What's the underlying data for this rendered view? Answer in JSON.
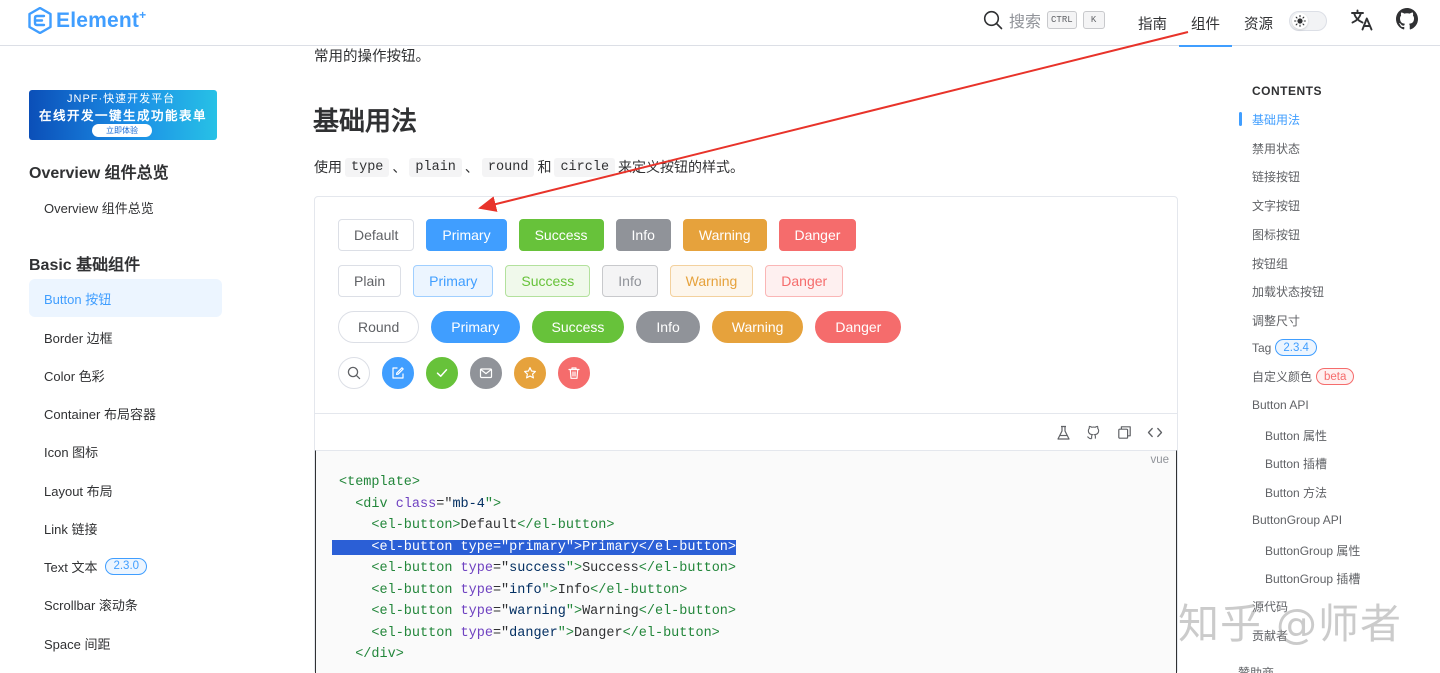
{
  "header": {
    "logo": "Element",
    "logo_sup": "+",
    "search_label": "搜索",
    "kbd_ctrl": "CTRL",
    "kbd_k": "K",
    "nav": [
      "指南",
      "组件",
      "资源"
    ]
  },
  "sidebar": {
    "banner_top": "JNPF·快速开发平台",
    "banner_main": "在线开发一键生成功能表单",
    "banner_btn": "立即体验",
    "section_overview": "Overview 组件总览",
    "item_overview": "Overview 组件总览",
    "section_basic": "Basic 基础组件",
    "items": [
      {
        "label": "Button 按钮"
      },
      {
        "label": "Border 边框"
      },
      {
        "label": "Color 色彩"
      },
      {
        "label": "Container 布局容器"
      },
      {
        "label": "Icon 图标"
      },
      {
        "label": "Layout 布局"
      },
      {
        "label": "Link 链接"
      },
      {
        "label": "Text 文本",
        "badge": "2.3.0"
      },
      {
        "label": "Scrollbar 滚动条"
      },
      {
        "label": "Space 间距"
      }
    ]
  },
  "main": {
    "intro": "常用的操作按钮。",
    "heading": "基础用法",
    "desc_use": "使用",
    "desc_sep": "、",
    "desc_and": "和",
    "desc_end": "来定义按钮的样式。",
    "desc_codes": [
      "type",
      "plain",
      "round",
      "circle"
    ],
    "row1": [
      "Default",
      "Primary",
      "Success",
      "Info",
      "Warning",
      "Danger"
    ],
    "row2": [
      "Plain",
      "Primary",
      "Success",
      "Info",
      "Warning",
      "Danger"
    ],
    "row3": [
      "Round",
      "Primary",
      "Success",
      "Info",
      "Warning",
      "Danger"
    ],
    "code_lang": "vue",
    "code_lines": [
      [
        "<template>"
      ],
      [
        "  <div ",
        "class",
        "=\"",
        "mb-4",
        "\">"
      ],
      [
        "    <el-button>",
        "Default",
        "</el-button>"
      ],
      [
        "    <el-button ",
        "type",
        "=\"",
        "primary",
        "\">",
        "Primary",
        "</el-button>"
      ],
      [
        "    <el-button ",
        "type",
        "=\"",
        "success",
        "\">",
        "Success",
        "</el-button>"
      ],
      [
        "    <el-button ",
        "type",
        "=\"",
        "info",
        "\">",
        "Info",
        "</el-button>"
      ],
      [
        "    <el-button ",
        "type",
        "=\"",
        "warning",
        "\">",
        "Warning",
        "</el-button>"
      ],
      [
        "    <el-button ",
        "type",
        "=\"",
        "danger",
        "\">",
        "Danger",
        "</el-button>"
      ],
      [
        "  </div>"
      ]
    ]
  },
  "toc": {
    "title": "CONTENTS",
    "items": [
      {
        "label": "基础用法"
      },
      {
        "label": "禁用状态"
      },
      {
        "label": "链接按钮"
      },
      {
        "label": "文字按钮"
      },
      {
        "label": "图标按钮"
      },
      {
        "label": "按钮组"
      },
      {
        "label": "加载状态按钮"
      },
      {
        "label": "调整尺寸"
      },
      {
        "label": "Tag",
        "badge": "2.3.4"
      },
      {
        "label": "自定义颜色",
        "badge": "beta"
      },
      {
        "label": "Button API"
      },
      {
        "label": "Button 属性"
      },
      {
        "label": "Button 插槽"
      },
      {
        "label": "Button 方法"
      },
      {
        "label": "ButtonGroup API"
      },
      {
        "label": "ButtonGroup 属性"
      },
      {
        "label": "ButtonGroup 插槽"
      },
      {
        "label": "源代码"
      },
      {
        "label": "贡献者"
      },
      {
        "label": "赞助商"
      }
    ]
  },
  "watermark": "知乎 @师者",
  "colors": {
    "primary": "#409eff",
    "success": "#67c23a",
    "info": "#909399",
    "warning": "#e6a23c",
    "danger": "#f56c6c",
    "annotation_arrow": "#e8332a"
  }
}
